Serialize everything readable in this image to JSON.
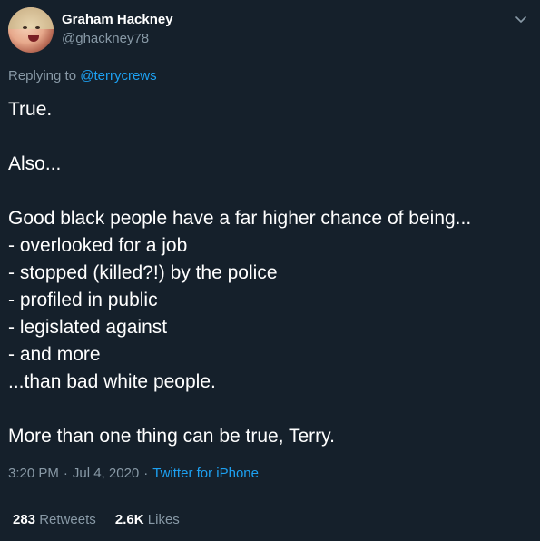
{
  "author": {
    "name": "Graham Hackney",
    "handle": "@ghackney78",
    "avatar_icon": "profile-photo"
  },
  "menu_icon": "chevron-down-icon",
  "reply": {
    "prefix": "Replying to",
    "to": "@terrycrews"
  },
  "tweet": {
    "lines": [
      "True.",
      "",
      "Also...",
      "",
      "Good black people have a far higher chance of being...",
      "- overlooked for a job",
      "- stopped (killed?!) by the police",
      "- profiled in public",
      "- legislated against",
      "- and more",
      "...than bad white people.",
      "",
      "More than one thing can be true, Terry."
    ]
  },
  "meta": {
    "time": "3:20 PM",
    "separator": "·",
    "date": "Jul 4, 2020",
    "source": "Twitter for iPhone"
  },
  "stats": {
    "retweets_count": "283",
    "retweets_label": "Retweets",
    "likes_count": "2.6K",
    "likes_label": "Likes"
  },
  "colors": {
    "background": "#15202b",
    "link": "#1da1f2",
    "secondary_text": "#8899a6",
    "primary_text": "#ffffff",
    "divider": "#38444d"
  }
}
